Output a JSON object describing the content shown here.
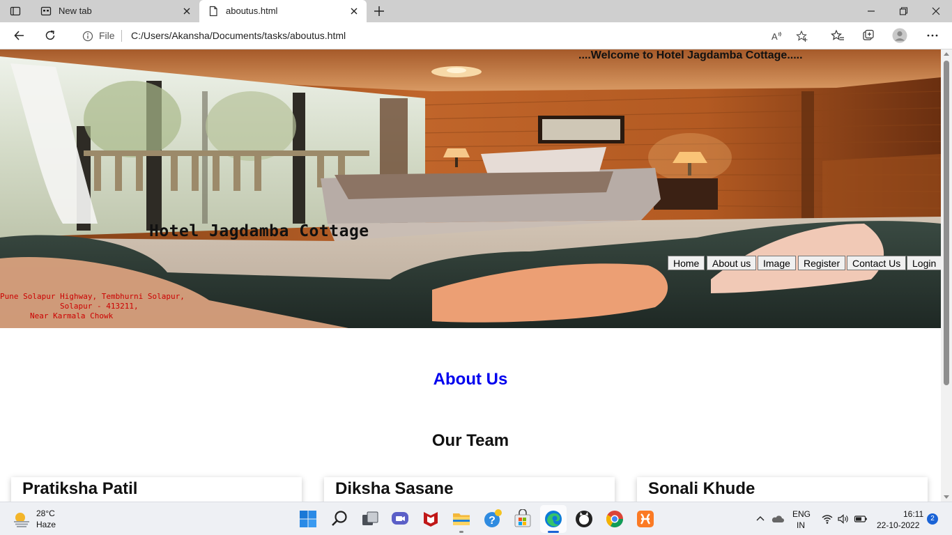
{
  "browser": {
    "tabs": [
      {
        "label": "New tab",
        "active": false
      },
      {
        "label": "aboutus.html",
        "active": true
      }
    ],
    "address": {
      "scheme_chip": "File",
      "url": "C:/Users/Akansha/Documents/tasks/aboutus.html"
    }
  },
  "page": {
    "welcome": "....Welcome to Hotel Jagdamba Cottage.....",
    "hotel_name": "Hotel Jagdamba Cottage",
    "nav": [
      "Home",
      "About us",
      "Image",
      "Register",
      "Contact Us",
      "Login"
    ],
    "address_lines": [
      "Pune Solapur Highway, Tembhurni Solapur,",
      "Solapur - 413211,",
      "Near Karmala Chowk"
    ],
    "about_heading": "About Us",
    "team_heading": "Our Team",
    "team": [
      "Pratiksha Patil",
      "Diksha Sasane",
      "Sonali Khude"
    ]
  },
  "taskbar": {
    "weather": {
      "temp": "28°C",
      "condition": "Haze"
    },
    "language": [
      "ENG",
      "IN"
    ],
    "time": "16:11",
    "date": "22-10-2022",
    "notifications": "2"
  },
  "colors": {
    "about_heading": "#0000ee",
    "address_text": "#cc0000",
    "taskbar_bg": "#eef0f4"
  }
}
